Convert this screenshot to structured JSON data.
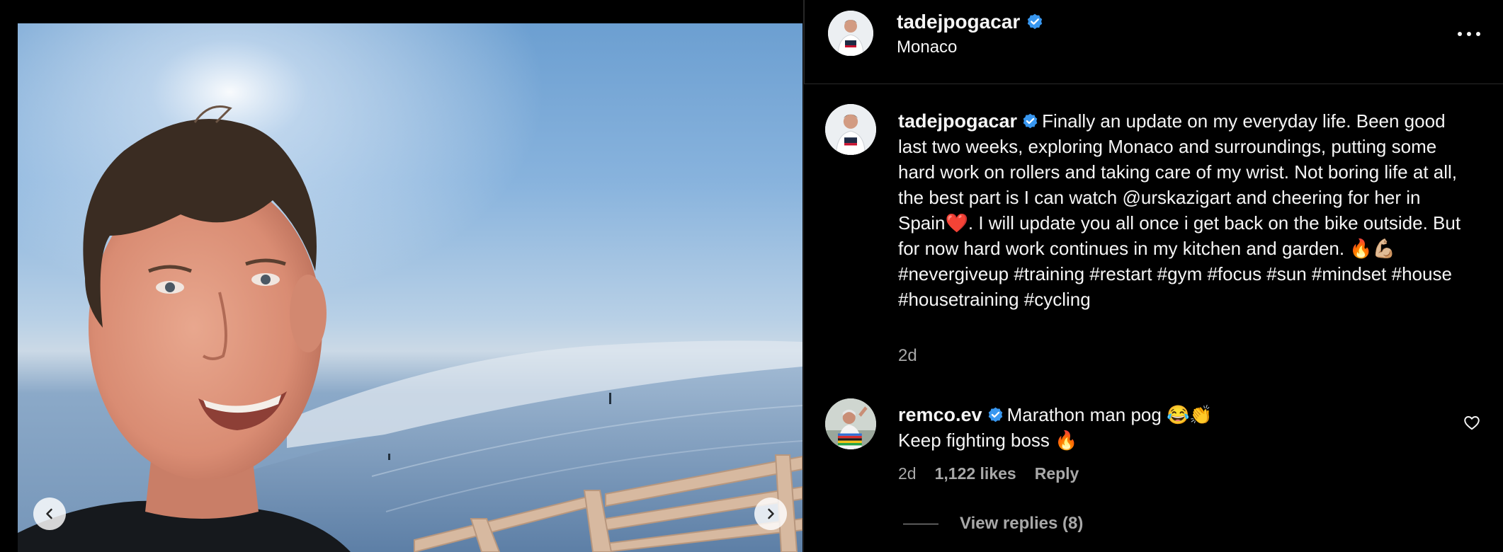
{
  "post": {
    "username": "tadejpogacar",
    "location": "Monaco",
    "verified_icon": "verified-badge-icon",
    "more_icon": "more-options-icon"
  },
  "media": {
    "prev_icon": "chevron-left-icon",
    "next_icon": "chevron-right-icon"
  },
  "caption": {
    "username": "tadejpogacar",
    "text": "Finally an update on my everyday life. Been good last two weeks, exploring Monaco and surroundings, putting some hard work on rollers and taking care of my wrist. Not boring life at all, the best part is I can watch @urskazigart and cheering for her in Spain❤️. I will update you all once i get back on the bike outside. But for now hard work continues in my kitchen and garden. 🔥💪🏼",
    "hashtags": "#nevergiveup #training #restart #gym #focus #sun #mindset #house #housetraining #cycling",
    "time": "2d"
  },
  "comment": {
    "username": "remco.ev",
    "line1": "Marathon man pog 😂👏",
    "line2": "Keep fighting boss 🔥",
    "time": "2d",
    "likes": "1,122 likes",
    "reply_label": "Reply",
    "view_replies": "View replies (8)",
    "like_icon": "heart-outline-icon"
  },
  "colors": {
    "background": "#000000",
    "text": "#f5f5f5",
    "secondary_text": "#a8a8a8",
    "verified_blue": "#3897f0",
    "divider": "#2a2a2a"
  }
}
